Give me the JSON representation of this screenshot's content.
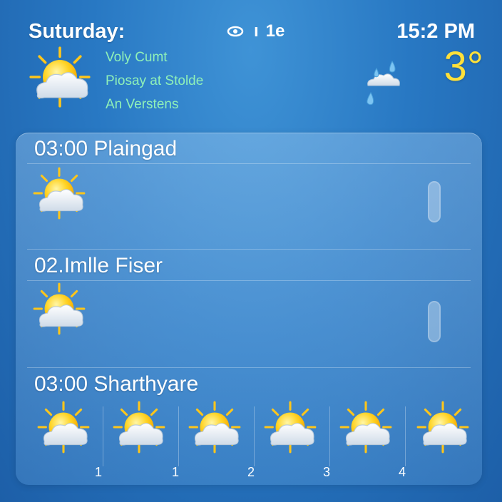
{
  "header": {
    "day": "Suturday:",
    "status_text": "1е",
    "status_glyph": "ı",
    "time": "15:2 PM",
    "temperature": "3°",
    "details": [
      "Voly Cumt",
      "Piosay at Stolde",
      "An Verstens"
    ]
  },
  "sections": [
    {
      "title": "03:00 Plaingad"
    },
    {
      "title": "02.Imlle Fiser"
    },
    {
      "title": "03:00 Sharthyare"
    }
  ],
  "forecast": {
    "labels": [
      "1",
      "1",
      "2",
      "3",
      "4",
      ""
    ]
  },
  "icons": {
    "hero": "partly-sunny-icon",
    "rain": "rain-cloud-icon",
    "status": "eye-icon"
  },
  "colors": {
    "accent_temp": "#ffe03a",
    "details_text": "#8ff0b8"
  }
}
